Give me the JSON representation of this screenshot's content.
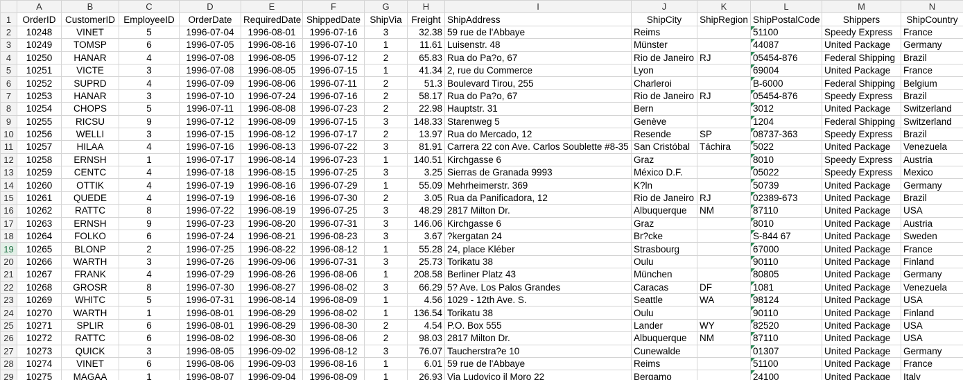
{
  "sheet": {
    "column_letters": [
      "A",
      "B",
      "C",
      "D",
      "E",
      "F",
      "G",
      "H",
      "I",
      "J",
      "K",
      "L",
      "M",
      "N"
    ],
    "header": [
      "OrderID",
      "CustomerID",
      "EmployeeID",
      "OrderDate",
      "RequiredDate",
      "ShippedDate",
      "ShipVia",
      "Freight",
      "ShipAddress",
      "ShipCity",
      "ShipRegion",
      "ShipPostalCode",
      "Shippers",
      "ShipCountry"
    ],
    "selected_row": 19,
    "rows": [
      [
        "10248",
        "VINET",
        "5",
        "1996-07-04",
        "1996-08-01",
        "1996-07-16",
        "3",
        "32.38",
        "59 rue de l'Abbaye",
        "Reims",
        "",
        "51100",
        "Speedy Express",
        "France"
      ],
      [
        "10249",
        "TOMSP",
        "6",
        "1996-07-05",
        "1996-08-16",
        "1996-07-10",
        "1",
        "11.61",
        "Luisenstr. 48",
        "Münster",
        "",
        "44087",
        "United Package",
        "Germany"
      ],
      [
        "10250",
        "HANAR",
        "4",
        "1996-07-08",
        "1996-08-05",
        "1996-07-12",
        "2",
        "65.83",
        "Rua do Pa?o, 67",
        "Rio de Janeiro",
        "RJ",
        "05454-876",
        "Federal Shipping",
        "Brazil"
      ],
      [
        "10251",
        "VICTE",
        "3",
        "1996-07-08",
        "1996-08-05",
        "1996-07-15",
        "1",
        "41.34",
        "2, rue du Commerce",
        "Lyon",
        "",
        "69004",
        "United Package",
        "France"
      ],
      [
        "10252",
        "SUPRD",
        "4",
        "1996-07-09",
        "1996-08-06",
        "1996-07-11",
        "2",
        "51.3",
        "Boulevard Tirou, 255",
        "Charleroi",
        "",
        "B-6000",
        "Federal Shipping",
        "Belgium"
      ],
      [
        "10253",
        "HANAR",
        "3",
        "1996-07-10",
        "1996-07-24",
        "1996-07-16",
        "2",
        "58.17",
        "Rua do Pa?o, 67",
        "Rio de Janeiro",
        "RJ",
        "05454-876",
        "Speedy Express",
        "Brazil"
      ],
      [
        "10254",
        "CHOPS",
        "5",
        "1996-07-11",
        "1996-08-08",
        "1996-07-23",
        "2",
        "22.98",
        "Hauptstr. 31",
        "Bern",
        "",
        "3012",
        "United Package",
        "Switzerland"
      ],
      [
        "10255",
        "RICSU",
        "9",
        "1996-07-12",
        "1996-08-09",
        "1996-07-15",
        "3",
        "148.33",
        "Starenweg 5",
        "Genève",
        "",
        "1204",
        "Federal Shipping",
        "Switzerland"
      ],
      [
        "10256",
        "WELLI",
        "3",
        "1996-07-15",
        "1996-08-12",
        "1996-07-17",
        "2",
        "13.97",
        "Rua do Mercado, 12",
        "Resende",
        "SP",
        "08737-363",
        "Speedy Express",
        "Brazil"
      ],
      [
        "10257",
        "HILAA",
        "4",
        "1996-07-16",
        "1996-08-13",
        "1996-07-22",
        "3",
        "81.91",
        "Carrera 22 con Ave. Carlos Soublette #8-35",
        "San Cristóbal",
        "Táchira",
        "5022",
        "United Package",
        "Venezuela"
      ],
      [
        "10258",
        "ERNSH",
        "1",
        "1996-07-17",
        "1996-08-14",
        "1996-07-23",
        "1",
        "140.51",
        "Kirchgasse 6",
        "Graz",
        "",
        "8010",
        "Speedy Express",
        "Austria"
      ],
      [
        "10259",
        "CENTC",
        "4",
        "1996-07-18",
        "1996-08-15",
        "1996-07-25",
        "3",
        "3.25",
        "Sierras de Granada 9993",
        "México D.F.",
        "",
        "05022",
        "Speedy Express",
        "Mexico"
      ],
      [
        "10260",
        "OTTIK",
        "4",
        "1996-07-19",
        "1996-08-16",
        "1996-07-29",
        "1",
        "55.09",
        "Mehrheimerstr. 369",
        "K?ln",
        "",
        "50739",
        "United Package",
        "Germany"
      ],
      [
        "10261",
        "QUEDE",
        "4",
        "1996-07-19",
        "1996-08-16",
        "1996-07-30",
        "2",
        "3.05",
        "Rua da Panificadora, 12",
        "Rio de Janeiro",
        "RJ",
        "02389-673",
        "United Package",
        "Brazil"
      ],
      [
        "10262",
        "RATTC",
        "8",
        "1996-07-22",
        "1996-08-19",
        "1996-07-25",
        "3",
        "48.29",
        "2817 Milton Dr.",
        "Albuquerque",
        "NM",
        "87110",
        "United Package",
        "USA"
      ],
      [
        "10263",
        "ERNSH",
        "9",
        "1996-07-23",
        "1996-08-20",
        "1996-07-31",
        "3",
        "146.06",
        "Kirchgasse 6",
        "Graz",
        "",
        "8010",
        "United Package",
        "Austria"
      ],
      [
        "10264",
        "FOLKO",
        "6",
        "1996-07-24",
        "1996-08-21",
        "1996-08-23",
        "3",
        "3.67",
        "?kergatan 24",
        "Br?cke",
        "",
        "S-844 67",
        "United Package",
        "Sweden"
      ],
      [
        "10265",
        "BLONP",
        "2",
        "1996-07-25",
        "1996-08-22",
        "1996-08-12",
        "1",
        "55.28",
        "24, place Kléber",
        "Strasbourg",
        "",
        "67000",
        "United Package",
        "France"
      ],
      [
        "10266",
        "WARTH",
        "3",
        "1996-07-26",
        "1996-09-06",
        "1996-07-31",
        "3",
        "25.73",
        "Torikatu 38",
        "Oulu",
        "",
        "90110",
        "United Package",
        "Finland"
      ],
      [
        "10267",
        "FRANK",
        "4",
        "1996-07-29",
        "1996-08-26",
        "1996-08-06",
        "1",
        "208.58",
        "Berliner Platz 43",
        "München",
        "",
        "80805",
        "United Package",
        "Germany"
      ],
      [
        "10268",
        "GROSR",
        "8",
        "1996-07-30",
        "1996-08-27",
        "1996-08-02",
        "3",
        "66.29",
        "5? Ave. Los Palos Grandes",
        "Caracas",
        "DF",
        "1081",
        "United Package",
        "Venezuela"
      ],
      [
        "10269",
        "WHITC",
        "5",
        "1996-07-31",
        "1996-08-14",
        "1996-08-09",
        "1",
        "4.56",
        "1029 - 12th Ave. S.",
        "Seattle",
        "WA",
        "98124",
        "United Package",
        "USA"
      ],
      [
        "10270",
        "WARTH",
        "1",
        "1996-08-01",
        "1996-08-29",
        "1996-08-02",
        "1",
        "136.54",
        "Torikatu 38",
        "Oulu",
        "",
        "90110",
        "United Package",
        "Finland"
      ],
      [
        "10271",
        "SPLIR",
        "6",
        "1996-08-01",
        "1996-08-29",
        "1996-08-30",
        "2",
        "4.54",
        "P.O. Box 555",
        "Lander",
        "WY",
        "82520",
        "United Package",
        "USA"
      ],
      [
        "10272",
        "RATTC",
        "6",
        "1996-08-02",
        "1996-08-30",
        "1996-08-06",
        "2",
        "98.03",
        "2817 Milton Dr.",
        "Albuquerque",
        "NM",
        "87110",
        "United Package",
        "USA"
      ],
      [
        "10273",
        "QUICK",
        "3",
        "1996-08-05",
        "1996-09-02",
        "1996-08-12",
        "3",
        "76.07",
        "Taucherstra?e 10",
        "Cunewalde",
        "",
        "01307",
        "United Package",
        "Germany"
      ],
      [
        "10274",
        "VINET",
        "6",
        "1996-08-06",
        "1996-09-03",
        "1996-08-16",
        "1",
        "6.01",
        "59 rue de l'Abbaye",
        "Reims",
        "",
        "51100",
        "United Package",
        "France"
      ],
      [
        "10275",
        "MAGAA",
        "1",
        "1996-08-07",
        "1996-09-04",
        "1996-08-09",
        "1",
        "26.93",
        "Via Ludovico il Moro 22",
        "Bergamo",
        "",
        "24100",
        "United Package",
        "Italy"
      ]
    ]
  }
}
